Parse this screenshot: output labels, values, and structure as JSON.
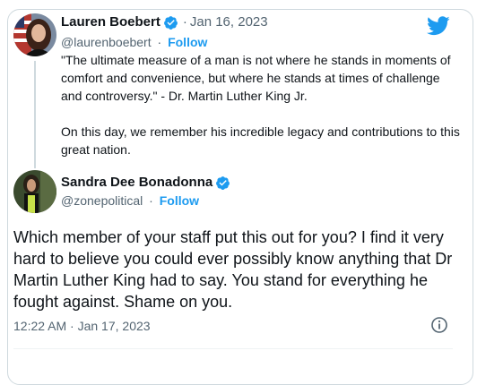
{
  "original_tweet": {
    "author_name": "Lauren Boebert",
    "date": "Jan 16, 2023",
    "handle": "@laurenboebert",
    "follow_label": "Follow",
    "paragraphs": [
      "\"The ultimate measure of a man is not where he stands in moments of comfort and convenience, but where he stands at times of challenge and controversy.\" - Dr. Martin Luther King Jr.",
      "On this day, we remember his incredible legacy and contributions to this great nation."
    ]
  },
  "reply_tweet": {
    "author_name": "Sandra Dee Bonadonna",
    "handle": "@zonepolitical",
    "follow_label": "Follow",
    "text": "Which member of your staff put this out for you? I find it very hard to believe you could ever possibly know anything that Dr Martin Luther King had to say. You stand for everything he fought against. Shame on you.",
    "timestamp": "12:22 AM · Jan 17, 2023"
  },
  "separators": {
    "dot": "·"
  },
  "icons": {
    "verified": "verified-badge-icon",
    "brand": "twitter-bird-icon",
    "info": "info-icon"
  },
  "colors": {
    "accent": "#1d9bf0",
    "text_primary": "#0f1419",
    "text_secondary": "#536471",
    "border": "#cfd9de"
  }
}
